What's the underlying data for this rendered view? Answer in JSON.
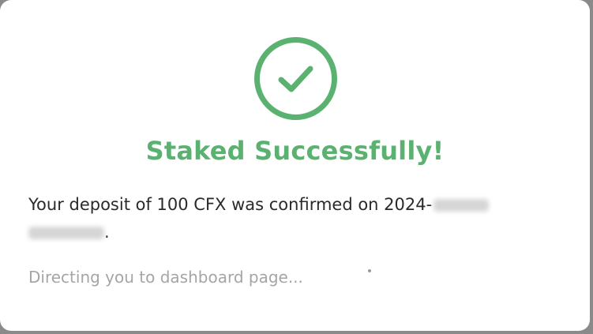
{
  "dialog": {
    "icon": "check-circle-icon",
    "title": "Staked Successfully!",
    "message_prefix": "Your deposit of 100 CFX was confirmed on 2024-",
    "message_suffix": ".",
    "status": "Directing you to dashboard page...",
    "accent_color": "#5bb270"
  }
}
